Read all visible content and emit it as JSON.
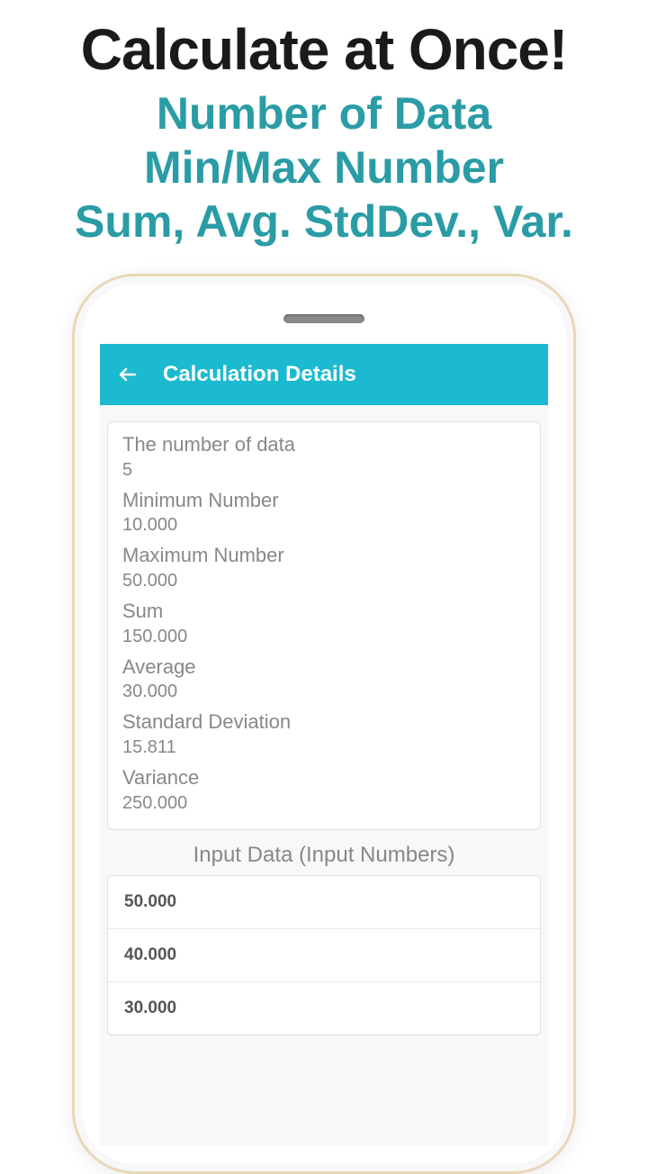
{
  "promo": {
    "title": "Calculate at Once!",
    "line1": "Number of Data",
    "line2": "Min/Max Number",
    "line3": "Sum, Avg. StdDev., Var."
  },
  "appBar": {
    "title": "Calculation Details"
  },
  "stats": [
    {
      "label": "The number of data",
      "value": "5"
    },
    {
      "label": "Minimum Number",
      "value": "10.000"
    },
    {
      "label": "Maximum Number",
      "value": "50.000"
    },
    {
      "label": "Sum",
      "value": "150.000"
    },
    {
      "label": "Average",
      "value": "30.000"
    },
    {
      "label": "Standard Deviation",
      "value": "15.811"
    },
    {
      "label": "Variance",
      "value": "250.000"
    }
  ],
  "inputSection": {
    "title": "Input Data (Input Numbers)"
  },
  "inputData": [
    "50.000",
    "40.000",
    "30.000"
  ]
}
